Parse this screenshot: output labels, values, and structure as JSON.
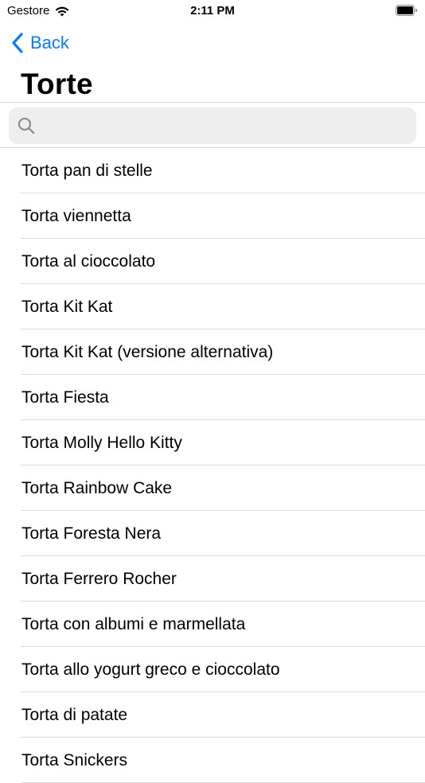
{
  "status_bar": {
    "carrier": "Gestore",
    "time": "2:11 PM"
  },
  "nav": {
    "back_label": "Back",
    "title": "Torte"
  },
  "search": {
    "placeholder": "",
    "value": ""
  },
  "colors": {
    "accent": "#0a7aff",
    "separator": "#dcdce0",
    "search_background": "#eeeeef",
    "search_icon": "#8e8e93"
  },
  "icons": {
    "back": "chevron-left-icon",
    "search": "search-icon",
    "wifi": "wifi-icon",
    "battery": "battery-icon"
  },
  "list": {
    "items": [
      "Torta pan di stelle",
      "Torta viennetta",
      "Torta al cioccolato",
      "Torta Kit Kat",
      "Torta Kit Kat (versione alternativa)",
      "Torta Fiesta",
      "Torta Molly Hello Kitty",
      "Torta Rainbow Cake",
      "Torta Foresta Nera",
      "Torta Ferrero Rocher",
      "Torta con albumi e marmellata",
      "Torta allo yogurt greco e cioccolato",
      "Torta di patate",
      "Torta Snickers"
    ]
  }
}
